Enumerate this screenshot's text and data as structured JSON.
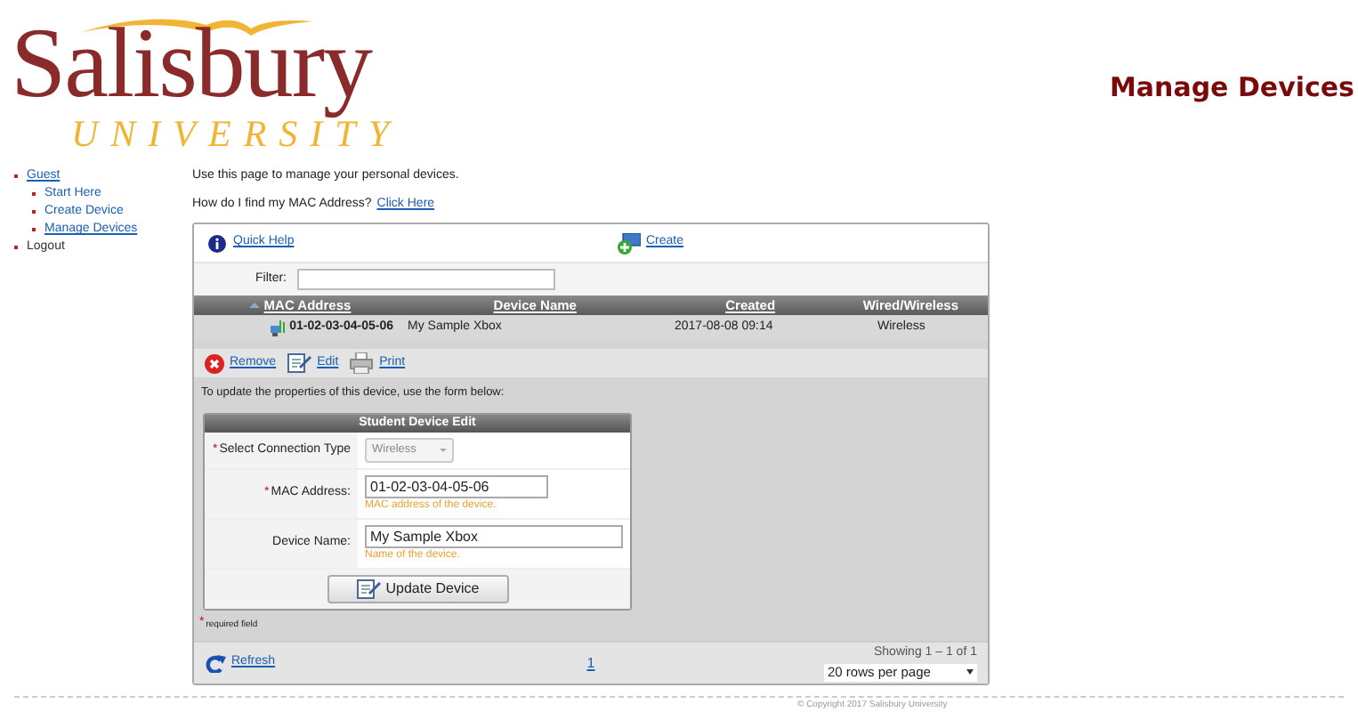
{
  "logo": {
    "name": "Salisbury",
    "subtitle": "UNIVERSITY"
  },
  "page_title": "Manage Devices",
  "nav": [
    {
      "label": "Guest",
      "selected": true,
      "children": [
        {
          "label": "Start Here",
          "selected": false
        },
        {
          "label": "Create Device",
          "selected": false
        },
        {
          "label": "Manage Devices",
          "selected": true
        }
      ]
    },
    {
      "label": "Logout",
      "selected": false
    }
  ],
  "intro": "Use this page to manage your personal devices.",
  "mac_help": {
    "text": "How do I find my MAC Address?",
    "link": "Click Here"
  },
  "toolbar": {
    "quick_help": "Quick Help",
    "create": "Create"
  },
  "filter": {
    "label": "Filter:"
  },
  "table": {
    "columns": [
      {
        "label": "MAC Address",
        "sorted": true
      },
      {
        "label": "Device Name",
        "sorted": false
      },
      {
        "label": "Created",
        "sorted": false
      },
      {
        "label": "Wired/Wireless",
        "sorted": false
      }
    ],
    "rows": [
      {
        "cells": [
          "01-02-03-04-05-06",
          "My Sample Xbox",
          "2017-08-08 09:14",
          "Wireless"
        ]
      }
    ]
  },
  "actions": [
    {
      "kind": "remove",
      "label": "Remove"
    },
    {
      "kind": "edit",
      "label": "Edit"
    },
    {
      "kind": "print",
      "label": "Print"
    }
  ],
  "form_note": "To update the properties of this device, use the form below:",
  "form": {
    "title": "Student Device Edit",
    "fields": [
      {
        "kind": "select",
        "label": "Select Connection Type",
        "required": true,
        "value": "Wireless",
        "disabled": true
      },
      {
        "kind": "text",
        "label": "MAC Address:",
        "required": true,
        "value": "01-02-03-04-05-06",
        "hint": "MAC address of the device."
      },
      {
        "kind": "text",
        "label": "Device Name:",
        "required": false,
        "value": "My Sample Xbox",
        "hint": "Name of the device."
      }
    ],
    "submit": "Update Device"
  },
  "required_note": {
    "mark": "*",
    "text": "required field"
  },
  "pager": {
    "refresh": "Refresh",
    "page": "1",
    "showing": "Showing 1 – 1 of 1",
    "rows_per_page": "20 rows per page"
  },
  "copyright": "© Copyright 2017 Salisbury University"
}
